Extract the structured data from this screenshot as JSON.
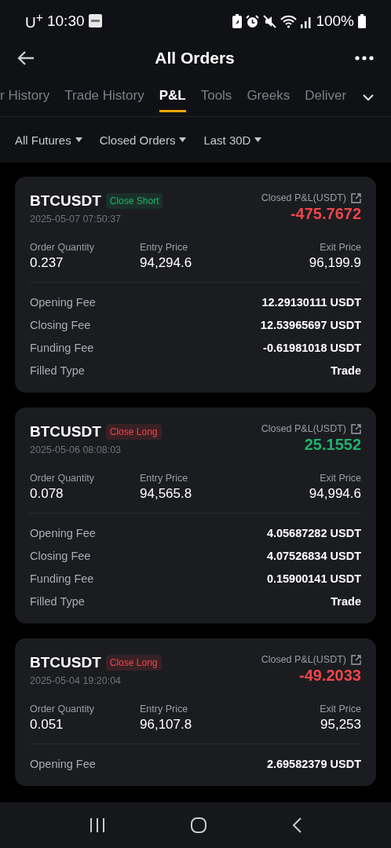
{
  "status_bar": {
    "carrier": "U$^{+}$",
    "time": "10:30",
    "battery": "100%"
  },
  "header": {
    "title": "All Orders"
  },
  "tabs": [
    {
      "label": "r History",
      "selected": false
    },
    {
      "label": "Trade History",
      "selected": false
    },
    {
      "label": "P&L",
      "selected": true
    },
    {
      "label": "Tools",
      "selected": false
    },
    {
      "label": "Greeks",
      "selected": false
    },
    {
      "label": "Deliver",
      "selected": false
    }
  ],
  "filters": [
    "All Futures",
    "Closed Orders",
    "Last 30D"
  ],
  "orders": [
    {
      "symbol": "BTCUSDT",
      "tag": {
        "label": "Close Short",
        "color": "#20b26c"
      },
      "time": "2025-05-07 07:50:37",
      "pnl_label": "Closed P&L(USDT)",
      "pnl": {
        "value": "-475.7672",
        "color": "#ef454a"
      },
      "stats": [
        {
          "label": "Order Quantity",
          "value": "0.237"
        },
        {
          "label": "Entry Price",
          "value": "94,294.6"
        },
        {
          "label": "Exit Price",
          "value": "96,199.9"
        }
      ],
      "fees": [
        {
          "label": "Opening Fee",
          "value": "12.29130111 USDT"
        },
        {
          "label": "Closing Fee",
          "value": "12.53965697 USDT"
        },
        {
          "label": "Funding Fee",
          "value": "-0.61981018 USDT"
        },
        {
          "label": "Filled Type",
          "value": "Trade"
        }
      ]
    },
    {
      "symbol": "BTCUSDT",
      "tag": {
        "label": "Close Long",
        "color": "#ef454a"
      },
      "time": "2025-05-06 08:08:03",
      "pnl_label": "Closed P&L(USDT)",
      "pnl": {
        "value": "25.1552",
        "color": "#20b26c"
      },
      "stats": [
        {
          "label": "Order Quantity",
          "value": "0.078"
        },
        {
          "label": "Entry Price",
          "value": "94,565.8"
        },
        {
          "label": "Exit Price",
          "value": "94,994.6"
        }
      ],
      "fees": [
        {
          "label": "Opening Fee",
          "value": "4.05687282 USDT"
        },
        {
          "label": "Closing Fee",
          "value": "4.07526834 USDT"
        },
        {
          "label": "Funding Fee",
          "value": "0.15900141 USDT"
        },
        {
          "label": "Filled Type",
          "value": "Trade"
        }
      ]
    },
    {
      "symbol": "BTCUSDT",
      "tag": {
        "label": "Close Long",
        "color": "#ef454a"
      },
      "time": "2025-05-04 19:20:04",
      "pnl_label": "Closed P&L(USDT)",
      "pnl": {
        "value": "-49.2033",
        "color": "#ef454a"
      },
      "stats": [
        {
          "label": "Order Quantity",
          "value": "0.051"
        },
        {
          "label": "Entry Price",
          "value": "96,107.8"
        },
        {
          "label": "Exit Price",
          "value": "95,253"
        }
      ],
      "fees": [
        {
          "label": "Opening Fee",
          "value": "2.69582379 USDT"
        }
      ]
    }
  ]
}
